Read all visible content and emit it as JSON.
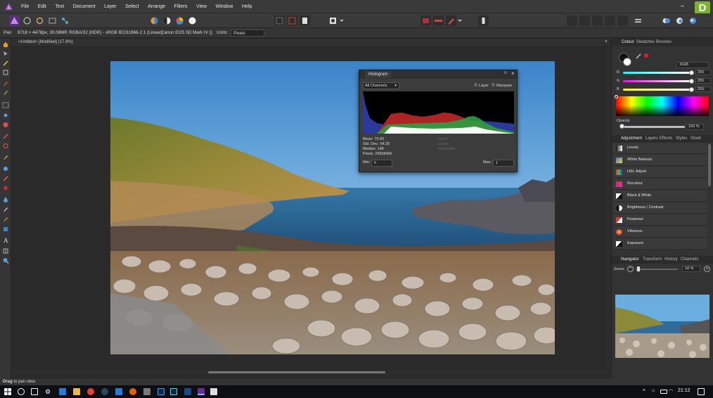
{
  "menubar": {
    "items": [
      "File",
      "Edit",
      "Text",
      "Document",
      "Layer",
      "Select",
      "Arrange",
      "Filters",
      "View",
      "Window",
      "Help"
    ],
    "badge": "D",
    "minimize": "–"
  },
  "contextbar": {
    "tool": "Pan",
    "info": "6718 × 4478px, 30.08MP, RGBA/32 (HDR) - sRGB IEC61966-2.1 (Linear)",
    "camera": "Canon EOS 5D Mark IV ()",
    "units_label": "Units:",
    "units_value": "Pixels"
  },
  "document": {
    "tab_title": "<Untitled> [Modified] (17.9%)"
  },
  "histogram": {
    "title": "Histogram",
    "channel": "All Channels",
    "layer_label": "Layer",
    "marquee_label": "Marquee",
    "stats": [
      "Mean: 75.60",
      "Std. Dev.: 64.25",
      "Median: 148",
      "Pixels: 29558466"
    ],
    "stats_disabled": [
      "Level:",
      "Count:",
      "Percentile:"
    ],
    "min_label": "Min:",
    "min_value": "0",
    "max_label": "Max:",
    "max_value": "1"
  },
  "colour_panel": {
    "tabs": [
      "Colour",
      "Swatches",
      "Brushes"
    ],
    "model": "RGB",
    "channels": [
      {
        "label": "R",
        "value": "255"
      },
      {
        "label": "G",
        "value": "255"
      },
      {
        "label": "B",
        "value": "255"
      }
    ],
    "opacity_label": "Opacity",
    "opacity_value": "100 %"
  },
  "adjustment_panel": {
    "tabs": [
      "Adjustment",
      "Layers",
      "Effects",
      "Styles",
      "Stock"
    ],
    "items": [
      "Levels",
      "White Balance",
      "HSL Adjust",
      "Recolour",
      "Black & White",
      "Brightness / Contrast",
      "Posterise",
      "Vibrance",
      "Exposure"
    ]
  },
  "navigator_panel": {
    "tabs": [
      "Navigator",
      "Transform",
      "History",
      "Channels"
    ],
    "zoom_label": "Zoom:",
    "zoom_value": "18 %"
  },
  "status": {
    "bold": "Drag",
    "text": " to pan view."
  },
  "taskbar": {
    "time": "21:12"
  },
  "colors": {
    "accent": "#7cb32e",
    "ui_dark": "#2b2b2b",
    "panel": "#333333"
  }
}
